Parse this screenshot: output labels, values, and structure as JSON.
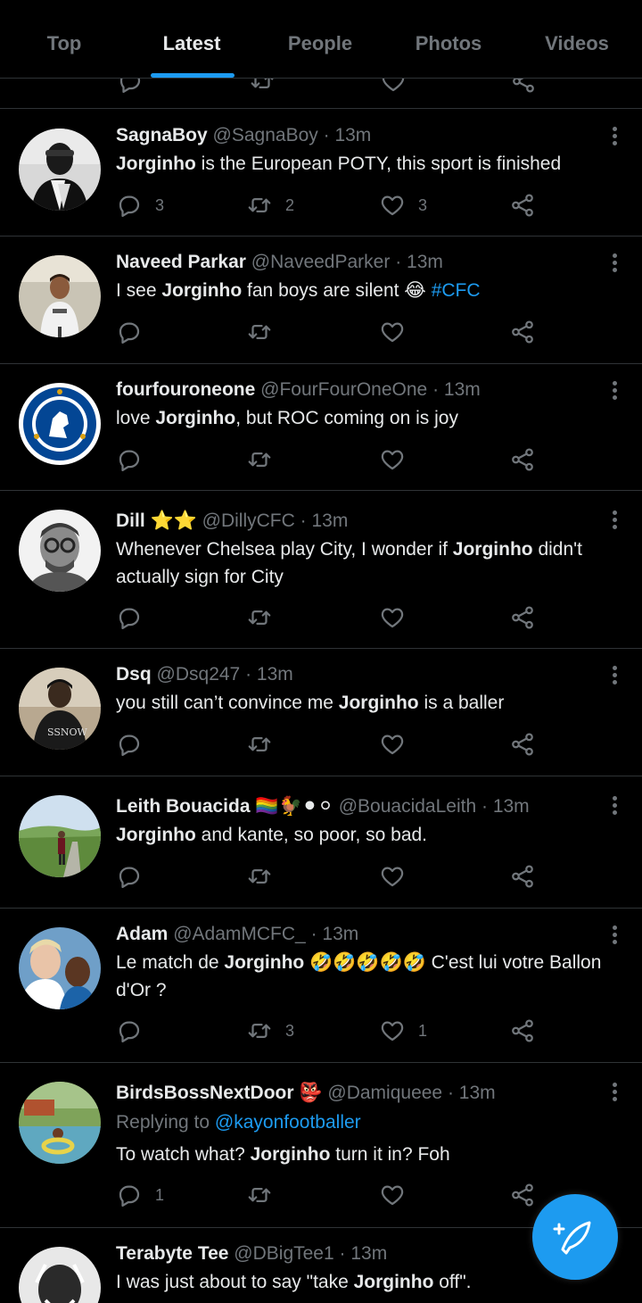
{
  "tabs": [
    {
      "label": "Top"
    },
    {
      "label": "Latest",
      "active": true
    },
    {
      "label": "People"
    },
    {
      "label": "Photos"
    },
    {
      "label": "Videos"
    }
  ],
  "accent_color": "#1d9bf0",
  "icons": {
    "reply": "reply-icon",
    "retweet": "retweet-icon",
    "like": "heart-icon",
    "share": "share-icon",
    "more": "more-icon",
    "compose": "compose-tweet-icon"
  },
  "tweets": [
    {
      "name": "SagnaBoy",
      "handle": "@SagnaBoy",
      "time": "· 13m",
      "text_parts": [
        {
          "b": "Jorginho"
        },
        " is the European POTY, this sport is finished"
      ],
      "replies": "3",
      "retweets": "2",
      "likes": "3"
    },
    {
      "name": "Naveed Parkar",
      "handle": "@NaveedParker",
      "time": "· 13m",
      "text_parts": [
        "I see ",
        {
          "b": "Jorginho"
        },
        " fan boys are silent 😂 ",
        {
          "tag": "#CFC"
        }
      ],
      "replies": "",
      "retweets": "",
      "likes": ""
    },
    {
      "name": "fourfouroneone",
      "handle": "@FourFourOneOne",
      "time": "· 13m",
      "text_parts": [
        "love ",
        {
          "b": "Jorginho"
        },
        ", but ROC coming on is joy"
      ],
      "replies": "",
      "retweets": "",
      "likes": ""
    },
    {
      "name": "Dill",
      "name_suffix": "⭐⭐",
      "handle": "@DillyCFC",
      "time": "· 13m",
      "text_parts": [
        "Whenever Chelsea play City, I wonder if ",
        {
          "b": "Jorginho"
        },
        " didn't actually sign for City"
      ],
      "replies": "",
      "retweets": "",
      "likes": ""
    },
    {
      "name": "Dsq",
      "handle": "@Dsq247",
      "time": "· 13m",
      "text_parts": [
        "you still can’t convince me ",
        {
          "b": "Jorginho"
        },
        " is a baller"
      ],
      "replies": "",
      "retweets": "",
      "likes": ""
    },
    {
      "name": "Leith Bouacida",
      "name_suffix": "🏳️‍🌈🐓⚫⚪",
      "handle": "@BouacidaLeith",
      "time": "· 13m",
      "text_parts": [
        {
          "b": "Jorginho"
        },
        " and kante, so poor, so bad."
      ],
      "replies": "",
      "retweets": "",
      "likes": ""
    },
    {
      "name": "Adam",
      "handle": "@AdamMCFC_",
      "time": "· 13m",
      "text_parts": [
        "Le match de ",
        {
          "b": "Jorginho"
        },
        " 🤣🤣🤣🤣🤣 C'est lui votre Ballon d'Or ?"
      ],
      "replies": "",
      "retweets": "3",
      "likes": "1"
    },
    {
      "name": "BirdsBossNextDoor",
      "name_suffix": "👺",
      "handle": "@Damiqueee",
      "time": "· 13m",
      "reply_label": "Replying to ",
      "reply_mention": "@kayonfootballer",
      "text_parts": [
        "To watch what? ",
        {
          "b": "Jorginho"
        },
        " turn it in? Foh"
      ],
      "replies": "1",
      "retweets": "",
      "likes": ""
    },
    {
      "name": "Terabyte Tee",
      "handle": "@DBigTee1",
      "time": "· 13m",
      "text_parts": [
        "I was just about to say \"take ",
        {
          "b": "Jorginho"
        },
        " off\"."
      ],
      "replies": "",
      "retweets": "",
      "likes": ""
    }
  ]
}
